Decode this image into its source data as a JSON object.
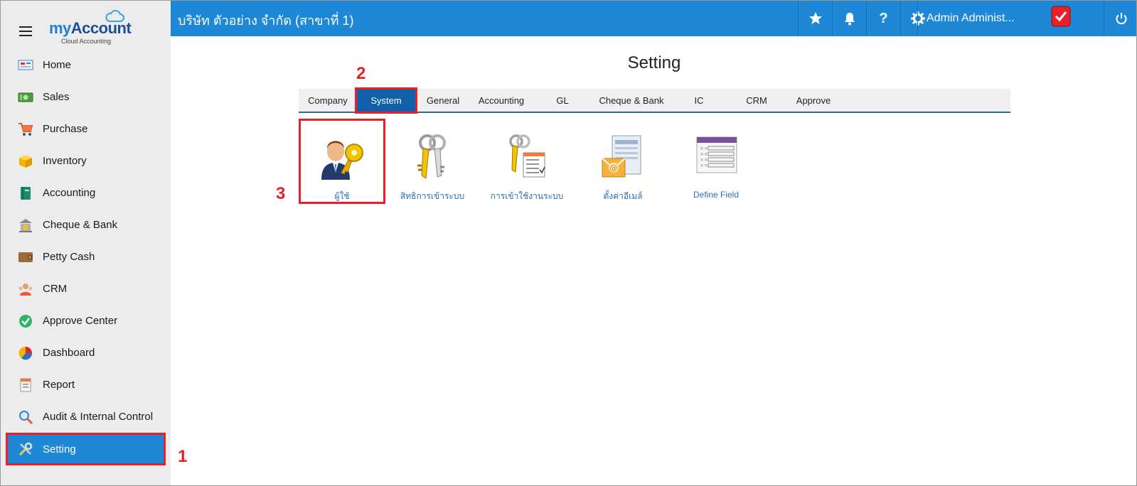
{
  "brand": {
    "logo_my": "my",
    "logo_account": "Account",
    "logo_sub": "Cloud Accounting"
  },
  "sidebar": {
    "items": [
      {
        "label": "Home",
        "icon": "home-icon"
      },
      {
        "label": "Sales",
        "icon": "sales-icon"
      },
      {
        "label": "Purchase",
        "icon": "cart-icon"
      },
      {
        "label": "Inventory",
        "icon": "box-icon"
      },
      {
        "label": "Accounting",
        "icon": "book-icon"
      },
      {
        "label": "Cheque & Bank",
        "icon": "bank-icon"
      },
      {
        "label": "Petty Cash",
        "icon": "wallet-icon"
      },
      {
        "label": "CRM",
        "icon": "crm-icon"
      },
      {
        "label": "Approve Center",
        "icon": "check-circle-icon"
      },
      {
        "label": "Dashboard",
        "icon": "pie-chart-icon"
      },
      {
        "label": "Report",
        "icon": "report-icon"
      },
      {
        "label": "Audit & Internal Control",
        "icon": "magnifier-icon"
      },
      {
        "label": "Setting",
        "icon": "tools-icon",
        "active": true
      }
    ]
  },
  "topbar": {
    "company": "บริษัท ตัวอย่าง จำกัด (สาขาที่ 1)",
    "user": "Admin Administ..."
  },
  "main": {
    "title": "Setting",
    "tabs": [
      {
        "label": "Company"
      },
      {
        "label": "System",
        "active": true
      },
      {
        "label": "General"
      },
      {
        "label": "Accounting"
      },
      {
        "label": "GL"
      },
      {
        "label": "Cheque & Bank"
      },
      {
        "label": "IC"
      },
      {
        "label": "CRM"
      },
      {
        "label": "Approve"
      }
    ],
    "tiles": [
      {
        "label": "ผู้ใช้",
        "icon": "user-key-icon"
      },
      {
        "label": "สิทธิการเข้าระบบ",
        "icon": "keys-icon"
      },
      {
        "label": "การเข้าใช้งานระบบ",
        "icon": "keys-list-icon"
      },
      {
        "label": "ตั้งค่าอีเมล์",
        "icon": "email-settings-icon"
      },
      {
        "label": "Define Field",
        "icon": "define-field-icon"
      }
    ]
  },
  "annotations": {
    "a1": "1",
    "a2": "2",
    "a3": "3"
  },
  "colors": {
    "accent": "#1e88d6",
    "active_tab": "#0f5fa9",
    "highlight": "#e8202a",
    "link": "#2c6fb8"
  }
}
